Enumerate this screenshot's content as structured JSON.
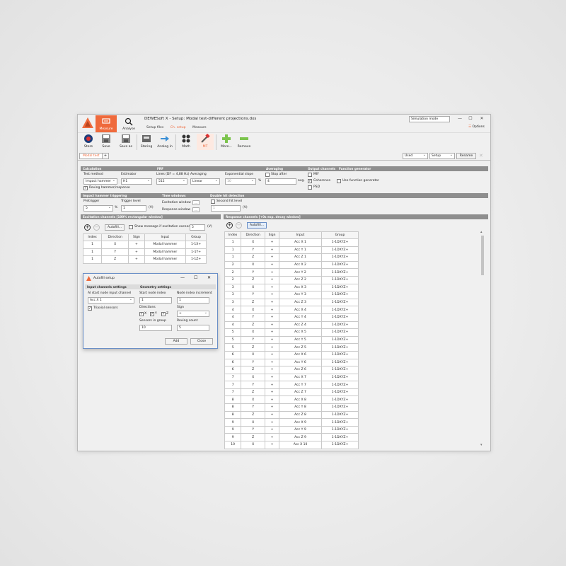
{
  "app": {
    "title": "DEWESoft X - Setup: Modal test-different projections.dxs",
    "modes": [
      {
        "label": "Measure"
      },
      {
        "label": "Analyse"
      }
    ],
    "subtabs": [
      "Setup files",
      "Ch. setup",
      "Measure"
    ],
    "simulation_mode": "Simulation mode",
    "options_label": "Options",
    "window_controls": [
      "—",
      "☐",
      "✕"
    ]
  },
  "toolbar": {
    "buttons": [
      {
        "label": "Store",
        "icon": "store-icon"
      },
      {
        "label": "Save",
        "icon": "save-icon"
      },
      {
        "label": "Save as",
        "icon": "save-as-icon"
      },
      {
        "label": "Storing",
        "icon": "storing-icon"
      },
      {
        "label": "Analog in",
        "icon": "analog-in-icon"
      },
      {
        "label": "Math",
        "icon": "math-icon"
      },
      {
        "label": "MT",
        "icon": "mt-icon"
      },
      {
        "label": "More...",
        "icon": "more-icon"
      },
      {
        "label": "Remove",
        "icon": "remove-icon"
      }
    ]
  },
  "tabs": {
    "active": "Modal test",
    "add": "+",
    "used_select": "Used",
    "setup_select": "Setup",
    "rename": "Rename"
  },
  "calculation": {
    "header": "Calculation",
    "test_method_label": "Test method",
    "test_method_value": "Impact hammer",
    "estimator_label": "Estimator",
    "estimator_value": "H1",
    "roving_label": "Roving hammer/response"
  },
  "frf": {
    "header": "FRF",
    "lines_label": "Lines (DF = 4,88 Hz)",
    "lines_value": "512",
    "averaging_label": "Averaging",
    "averaging_value": "Linear",
    "exp_slope_label": "Exponential slope",
    "exp_slope_value": "10",
    "exp_slope_unit": "%"
  },
  "averaging": {
    "header": "Averaging",
    "stop_after_label": "Stop after",
    "stop_after_value": "4",
    "stop_after_unit": "avg."
  },
  "output_channels": {
    "header": "Output channels",
    "items": [
      {
        "label": "MIF",
        "checked": false
      },
      {
        "label": "Coherence",
        "checked": true
      },
      {
        "label": "PSD",
        "checked": false
      }
    ]
  },
  "function_generator": {
    "header": "Function generator",
    "use_label": "Use function generator"
  },
  "impact_trigger": {
    "header": "Impact hammer triggering",
    "pretrigger_label": "Pretrigger",
    "pretrigger_value": "5",
    "pretrigger_unit": "%",
    "trigger_level_label": "Trigger level",
    "trigger_level_value": "1",
    "trigger_level_unit": "(V)"
  },
  "time_windows": {
    "header": "Time windows",
    "excitation_label": "Excitation window",
    "response_label": "Response window",
    "dots": "..."
  },
  "double_hit": {
    "header": "Double hit detection",
    "second_hit_label": "Second hit level",
    "level_value": "1",
    "level_unit": "(V)"
  },
  "excitation_channels": {
    "header": "Excitation channels [100% rectangular window]",
    "autofill": "Autofill...",
    "show_message_label": "Show message if excitation exceeds",
    "show_message_value": "5",
    "show_message_unit": "(V)",
    "columns": [
      "Index",
      "Direction",
      "Sign",
      "Input",
      "Group"
    ],
    "rows": [
      [
        "1",
        "X",
        "+",
        "Modal hammer",
        "1-1X+"
      ],
      [
        "1",
        "Y",
        "+",
        "Modal hammer",
        "1-1Y+"
      ],
      [
        "1",
        "Z",
        "+",
        "Modal hammer",
        "1-1Z+"
      ]
    ]
  },
  "response_channels": {
    "header": "Response channels [+0s exp. decay window]",
    "autofill": "Autofill...",
    "columns": [
      "Index",
      "Direction",
      "Sign",
      "Input",
      "Group"
    ],
    "rows": [
      [
        "1",
        "X",
        "+",
        "Acc X 1",
        "1-1DXYZ+"
      ],
      [
        "1",
        "Y",
        "+",
        "Acc Y 1",
        "1-1DXYZ+"
      ],
      [
        "1",
        "Z",
        "+",
        "Acc Z 1",
        "1-1DXYZ+"
      ],
      [
        "2",
        "X",
        "+",
        "Acc X 2",
        "1-1DXYZ+"
      ],
      [
        "2",
        "Y",
        "+",
        "Acc Y 2",
        "1-1DXYZ+"
      ],
      [
        "2",
        "Z",
        "+",
        "Acc Z 2",
        "1-1DXYZ+"
      ],
      [
        "3",
        "X",
        "+",
        "Acc X 3",
        "1-1DXYZ+"
      ],
      [
        "3",
        "Y",
        "+",
        "Acc Y 3",
        "1-1DXYZ+"
      ],
      [
        "3",
        "Z",
        "+",
        "Acc Z 3",
        "1-1DXYZ+"
      ],
      [
        "4",
        "X",
        "+",
        "Acc X 4",
        "1-1DXYZ+"
      ],
      [
        "4",
        "Y",
        "+",
        "Acc Y 4",
        "1-1DXYZ+"
      ],
      [
        "4",
        "Z",
        "+",
        "Acc Z 4",
        "1-1DXYZ+"
      ],
      [
        "5",
        "X",
        "+",
        "Acc X 5",
        "1-1DXYZ+"
      ],
      [
        "5",
        "Y",
        "+",
        "Acc Y 5",
        "1-1DXYZ+"
      ],
      [
        "5",
        "Z",
        "+",
        "Acc Z 5",
        "1-1DXYZ+"
      ],
      [
        "6",
        "X",
        "+",
        "Acc X 6",
        "1-1DXYZ+"
      ],
      [
        "6",
        "Y",
        "+",
        "Acc Y 6",
        "1-1DXYZ+"
      ],
      [
        "6",
        "Z",
        "+",
        "Acc Z 6",
        "1-1DXYZ+"
      ],
      [
        "7",
        "X",
        "+",
        "Acc X 7",
        "1-1DXYZ+"
      ],
      [
        "7",
        "Y",
        "+",
        "Acc Y 7",
        "1-1DXYZ+"
      ],
      [
        "7",
        "Z",
        "+",
        "Acc Z 7",
        "1-1DXYZ+"
      ],
      [
        "8",
        "X",
        "+",
        "Acc X 8",
        "1-1DXYZ+"
      ],
      [
        "8",
        "Y",
        "+",
        "Acc Y 8",
        "1-1DXYZ+"
      ],
      [
        "8",
        "Z",
        "+",
        "Acc Z 8",
        "1-1DXYZ+"
      ],
      [
        "9",
        "X",
        "+",
        "Acc X 9",
        "1-1DXYZ+"
      ],
      [
        "9",
        "Y",
        "+",
        "Acc Y 9",
        "1-1DXYZ+"
      ],
      [
        "9",
        "Z",
        "+",
        "Acc Z 9",
        "1-1DXYZ+"
      ],
      [
        "10",
        "X",
        "+",
        "Acc X 10",
        "1-1DXYZ+"
      ]
    ]
  },
  "autofill_dialog": {
    "title": "Autofill setup",
    "input_header": "Input channels settings",
    "geometry_header": "Geometry settings",
    "ai_start_label": "AI start node input channel",
    "ai_start_value": "Acc X 1",
    "triaxial_label": "Triaxial sensors",
    "start_node_label": "Start node index",
    "start_node_value": "1",
    "node_inc_label": "Node index increment",
    "node_inc_value": "1",
    "directions_label": "Directions",
    "directions": [
      "X",
      "Y",
      "Z"
    ],
    "sign_label": "Sign",
    "sign_value": "+",
    "sensors_label": "Sensors in group",
    "sensors_value": "10",
    "roving_label": "Roving count",
    "roving_value": "5",
    "add": "Add",
    "close": "Close"
  },
  "colors": {
    "accent": "#ef6a3c",
    "header": "#8e8e8e"
  }
}
